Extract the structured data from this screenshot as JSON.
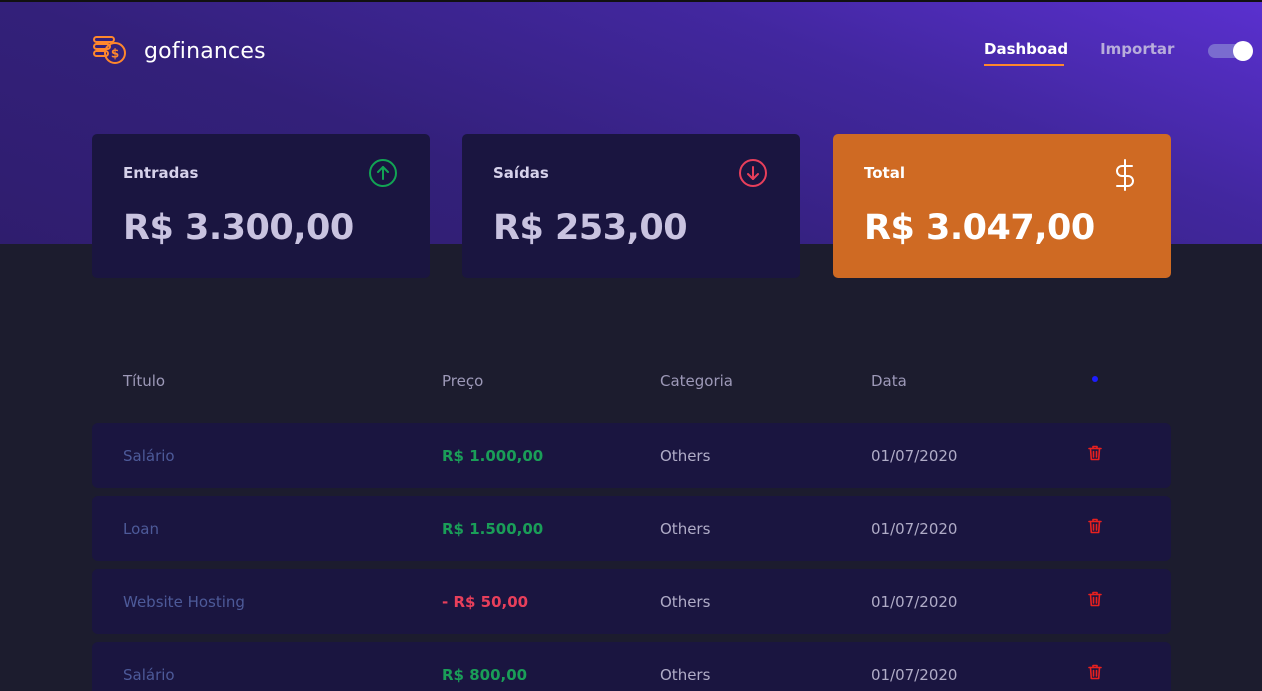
{
  "app": {
    "name": "gofinances"
  },
  "nav": {
    "items": [
      {
        "label": "Dashboad",
        "active": true
      },
      {
        "label": "Importar",
        "active": false
      }
    ]
  },
  "theme_toggle": {
    "on": true
  },
  "cards": {
    "income": {
      "title": "Entradas",
      "value": "R$ 3.300,00",
      "icon": "arrow-up-circle-icon"
    },
    "outcome": {
      "title": "Saídas",
      "value": "R$ 253,00",
      "icon": "arrow-down-circle-icon"
    },
    "total": {
      "title": "Total",
      "value": "R$ 3.047,00",
      "icon": "dollar-icon"
    }
  },
  "table": {
    "headers": {
      "title": "Título",
      "price": "Preço",
      "category": "Categoria",
      "date": "Data"
    },
    "rows": [
      {
        "title": "Salário",
        "price": "R$ 1.000,00",
        "type": "income",
        "category": "Others",
        "date": "01/07/2020"
      },
      {
        "title": "Loan",
        "price": "R$ 1.500,00",
        "type": "income",
        "category": "Others",
        "date": "01/07/2020"
      },
      {
        "title": "Website Hosting",
        "price": "- R$ 50,00",
        "type": "outcome",
        "category": "Others",
        "date": "01/07/2020"
      },
      {
        "title": "Salário",
        "price": "R$ 800,00",
        "type": "income",
        "category": "Others",
        "date": "01/07/2020"
      }
    ]
  },
  "colors": {
    "accent": "#ff872c",
    "income": "#1a9e58",
    "outcome": "#e83f5b",
    "total_card": "#cf6a23",
    "header": "#42279f"
  }
}
